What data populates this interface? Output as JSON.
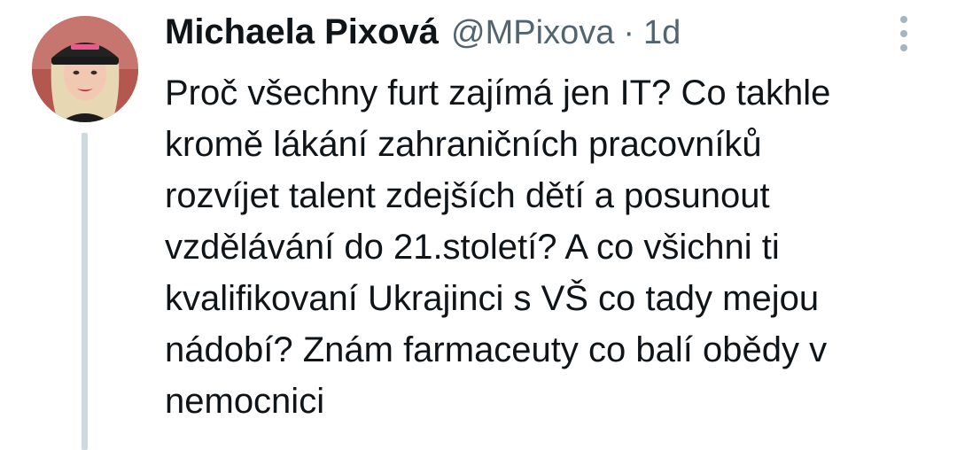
{
  "tweet": {
    "author_name": "Michaela Pixová",
    "handle": "@MPixova",
    "separator": "·",
    "time": "1d",
    "text": "Proč všechny furt zajímá jen IT? Co takhle\nkromě lákání zahraničních pracovníků\nrozvíjet talent zdejších dětí a posunout\nvzdělávání do 21.století? A co všichni ti\nkvalifikovaní Ukrajinci s VŠ co tady mejou\nnádobí? Znám farmaceuty co balí obědy v\nnemocnici",
    "avatar_icon": "profile-photo"
  },
  "colors": {
    "text_primary": "#0f1419",
    "text_secondary": "#536471",
    "thread_line": "#cfd9de",
    "more_dots": "#a8b4bd"
  }
}
